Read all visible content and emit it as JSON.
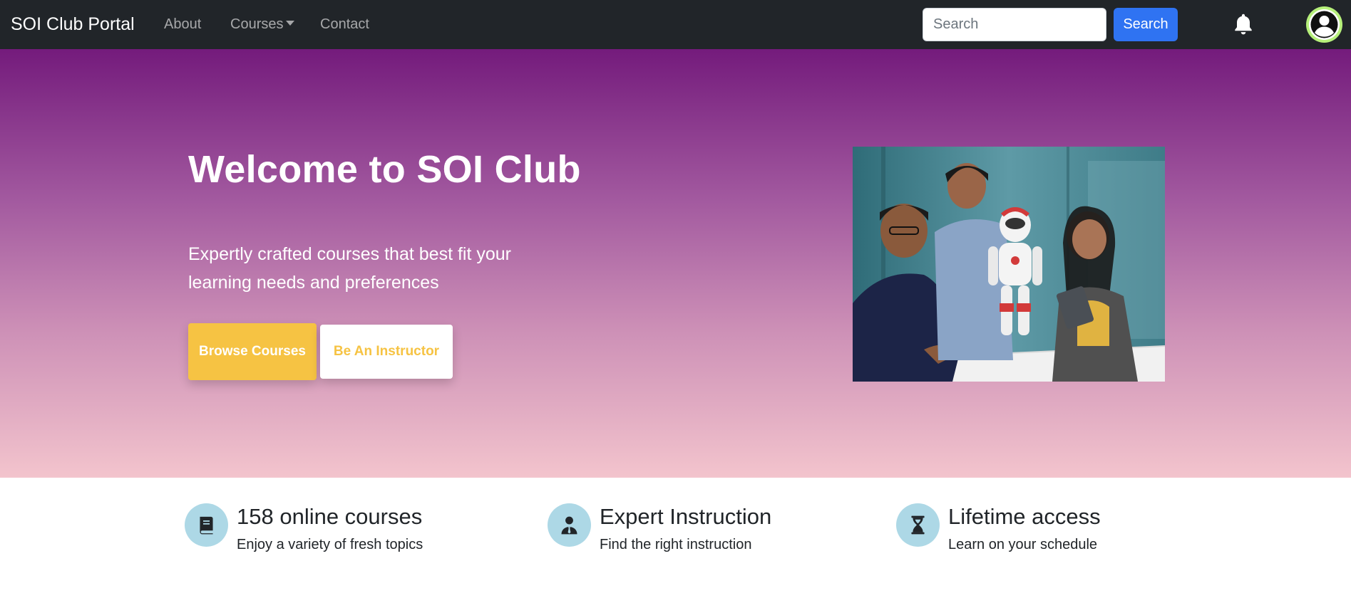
{
  "navbar": {
    "brand": "SOI Club Portal",
    "links": [
      "About",
      "Courses",
      "Contact"
    ],
    "search_placeholder": "Search",
    "search_button": "Search",
    "bell_icon": "bell-icon",
    "avatar_icon": "user-circle-icon"
  },
  "hero": {
    "title": "Welcome to SOI Club",
    "subtitle": "Expertly crafted courses that best fit your learning needs and preferences",
    "primary_button": "Browse Courses",
    "secondary_button": "Be An Instructor"
  },
  "features": [
    {
      "icon": "book-icon",
      "title": "158 online courses",
      "subtitle": "Enjoy a variety of fresh topics"
    },
    {
      "icon": "instructor-icon",
      "title": "Expert Instruction",
      "subtitle": "Find the right instruction"
    },
    {
      "icon": "hourglass-icon",
      "title": "Lifetime access",
      "subtitle": "Learn on your schedule"
    }
  ],
  "colors": {
    "navbar_bg": "#212529",
    "search_button": "#2f73f2",
    "accent_yellow": "#f6c343",
    "hero_top": "#741b7c",
    "hero_bottom": "#f3c4cd",
    "feature_icon_bg": "#add8e6",
    "avatar_ring": "#b6f07a"
  }
}
